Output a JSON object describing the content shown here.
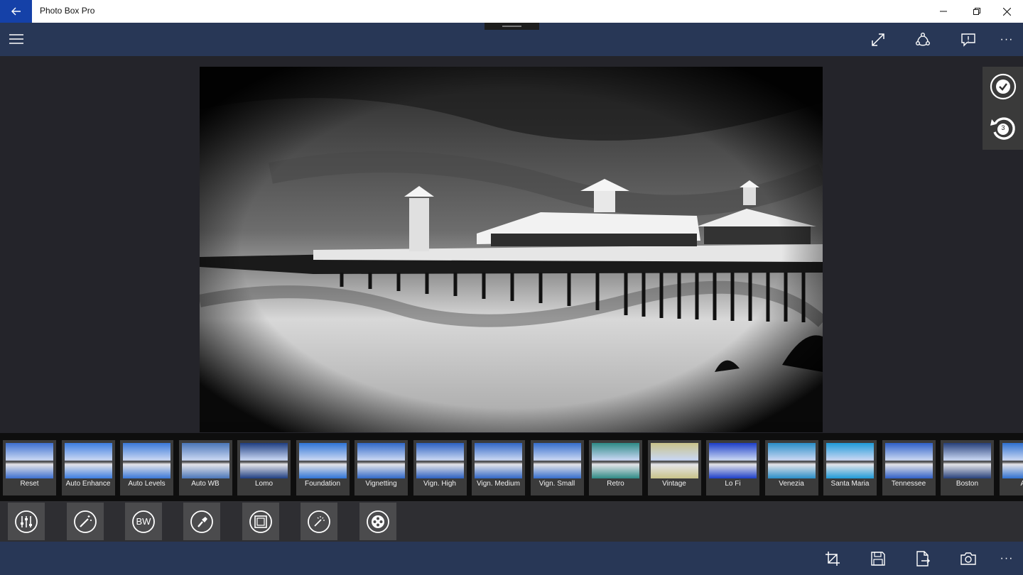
{
  "window": {
    "title": "Photo Box Pro"
  },
  "titlebar_icons": {
    "back": "back-arrow-icon",
    "minimize": "minimize-icon",
    "restore": "restore-icon",
    "close": "close-icon"
  },
  "appbar": {
    "menu_icon": "hamburger-menu-icon",
    "actions": [
      {
        "name": "fullscreen-icon"
      },
      {
        "name": "share-icon"
      },
      {
        "name": "feedback-icon"
      },
      {
        "name": "more-icon",
        "text": "···"
      }
    ]
  },
  "side_panel": {
    "apply_icon": "checkmark-circle-icon",
    "undo_icon": "undo-icon",
    "undo_count": "3"
  },
  "filters": [
    {
      "label": "Reset",
      "tint": "#3d6fcf"
    },
    {
      "label": "Auto Enhance",
      "tint": "#3c7de0"
    },
    {
      "label": "Auto Levels",
      "tint": "#3a78d8"
    },
    {
      "label": "Auto WB",
      "tint": "#4a76b8"
    },
    {
      "label": "Lomo",
      "tint": "#1f3f82"
    },
    {
      "label": "Foundation",
      "tint": "#2f74d6"
    },
    {
      "label": "Vignetting",
      "tint": "#3068c8"
    },
    {
      "label": "Vign. High",
      "tint": "#2c60c0"
    },
    {
      "label": "Vign. Medium",
      "tint": "#3166c5"
    },
    {
      "label": "Vign. Small",
      "tint": "#356dcc"
    },
    {
      "label": "Retro",
      "tint": "#2e8a86"
    },
    {
      "label": "Vintage",
      "tint": "#c9c38a"
    },
    {
      "label": "Lo Fi",
      "tint": "#1d3fc8"
    },
    {
      "label": "Venezia",
      "tint": "#2a8ec8"
    },
    {
      "label": "Santa Maria",
      "tint": "#1f9ad8"
    },
    {
      "label": "Tennessee",
      "tint": "#2f5fc6"
    },
    {
      "label": "Boston",
      "tint": "#27407a"
    },
    {
      "label": "Ant",
      "tint": "#2f70d0"
    }
  ],
  "tools": [
    {
      "name": "adjust-sliders-icon"
    },
    {
      "name": "magic-wand-icon"
    },
    {
      "name": "bw-icon",
      "text": "BW"
    },
    {
      "name": "paint-brush-icon"
    },
    {
      "name": "frame-icon"
    },
    {
      "name": "effects-wand-icon"
    },
    {
      "name": "film-reel-icon"
    }
  ],
  "bottombar": {
    "actions": [
      {
        "name": "crop-icon"
      },
      {
        "name": "save-icon"
      },
      {
        "name": "export-file-icon"
      },
      {
        "name": "camera-icon"
      },
      {
        "name": "more-icon",
        "text": "···"
      }
    ]
  }
}
